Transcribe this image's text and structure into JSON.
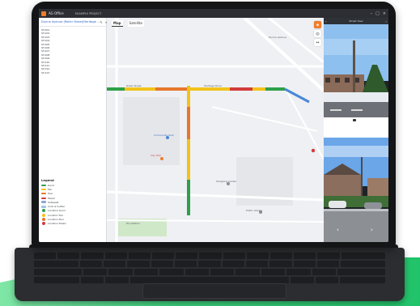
{
  "titlebar": {
    "app_title": "AG Office",
    "tab_label": "EXAMPLE PROJECT",
    "controls": [
      "minimize-icon",
      "maximize-icon",
      "close-icon"
    ]
  },
  "sidebar": {
    "project_label": "Dunne Avenue (Roller Street/Heritage ...",
    "rows": [
      "ST-001",
      "ST-002",
      "ST-003",
      "ST-004",
      "ST-005",
      "ST-006",
      "ST-007",
      "ST-008",
      "ST-009",
      "ST-010",
      "ST-011",
      "ST-012",
      "ST-013"
    ],
    "icons": [
      "edit-icon",
      "menu-icon"
    ]
  },
  "legend": {
    "title": "Legend",
    "items": [
      {
        "label": "Good",
        "color": "#2e9f4a",
        "shape": "line"
      },
      {
        "label": "Fair",
        "color": "#f2c21a",
        "shape": "line"
      },
      {
        "label": "Poor",
        "color": "#e6772b",
        "shape": "line"
      },
      {
        "label": "Failed",
        "color": "#d33b3b",
        "shape": "line"
      },
      {
        "label": "Sidewalk",
        "color": "#8aa9cf",
        "shape": "box"
      },
      {
        "label": "Curb & Gutter",
        "color": "#9fc3e6",
        "shape": "box"
      },
      {
        "label": "Location Good",
        "color": "#2e9f4a",
        "shape": "dot"
      },
      {
        "label": "Location Fair",
        "color": "#f2c21a",
        "shape": "dot"
      },
      {
        "label": "Location Poor",
        "color": "#e6772b",
        "shape": "dot"
      },
      {
        "label": "Location Failed",
        "color": "#d33b3b",
        "shape": "dot"
      }
    ]
  },
  "map": {
    "tabs": [
      {
        "label": "Map",
        "active": true
      },
      {
        "label": "Satellite",
        "active": false
      }
    ],
    "tools": [
      "layers-icon",
      "location-icon",
      "measure-icon"
    ],
    "labels": [
      {
        "text": "Roller Street",
        "style": ""
      },
      {
        "text": "Heritage Drive",
        "style": ""
      },
      {
        "text": "Dunne Avenue",
        "style": ""
      },
      {
        "text": "Community Park",
        "style": "blue"
      },
      {
        "text": "City Hall",
        "style": "red"
      },
      {
        "text": "Shopping Center",
        "style": ""
      },
      {
        "text": "Public Library",
        "style": ""
      },
      {
        "text": "Fire Station",
        "style": ""
      }
    ],
    "route_colors": {
      "good": "#2e9f4a",
      "fair": "#f2c21a",
      "poor": "#e6772b",
      "failed": "#d33b3b",
      "road": "#ffffff",
      "park": "#cfe8c8",
      "water": "#a9cdf2"
    }
  },
  "panel": {
    "header": "Street View",
    "nav": [
      "previous-icon",
      "next-icon"
    ]
  }
}
